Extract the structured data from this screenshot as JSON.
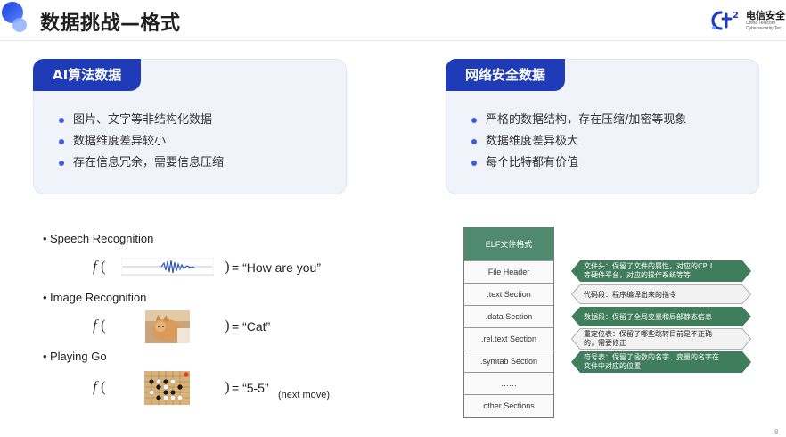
{
  "header": {
    "title": "数据挑战—格式",
    "logo": {
      "name": "电信安全",
      "sub_line1": "China Telecom",
      "sub_line2": "Cybersecurity Tec"
    }
  },
  "ai_panel": {
    "tag": "AI算法数据",
    "items": [
      "图片、文字等非结构化数据",
      "数据维度差异较小",
      "存在信息冗余，需要信息压缩"
    ]
  },
  "net_panel": {
    "tag": "网络安全数据",
    "items": [
      "严格的数据结构，存在压缩/加密等现象",
      "数据维度差异极大",
      "每个比特都有价值"
    ]
  },
  "examples": [
    {
      "label": "Speech Recognition",
      "result": "= “How are you”",
      "note": ""
    },
    {
      "label": "Image Recognition",
      "result": "= “Cat”",
      "note": ""
    },
    {
      "label": "Playing Go",
      "result": "= “5-5”",
      "note": "(next move)"
    }
  ],
  "math": {
    "func": "f",
    "open": "(",
    "close": ")"
  },
  "elf": {
    "title": "ELF文件格式",
    "rows": [
      "File Header",
      ".text Section",
      ".data Section",
      ".rel.text Section",
      ".symtab Section",
      "……",
      "other Sections"
    ]
  },
  "callouts": [
    {
      "line1": "文件头：保留了文件的属性，对应的CPU",
      "line2": "等硬件平台，对应的操作系统等等",
      "fill": "#3f7d5d",
      "text_color": "#ffffff"
    },
    {
      "line1": "代码段：程序编译出来的指令",
      "line2": "",
      "fill": "#f2f2f2",
      "text_color": "#222222"
    },
    {
      "line1": "数据段：保留了全局变量和局部静态信息",
      "line2": "",
      "fill": "#3f7d5d",
      "text_color": "#ffffff"
    },
    {
      "line1": "重定位表：保留了哪些跳转目前是不正确",
      "line2": "的，需要修正",
      "fill": "#f2f2f2",
      "text_color": "#222222"
    },
    {
      "line1": "符号表：保留了函数的名字、变量的名字在",
      "line2": "文件中对应的位置",
      "fill": "#3f7d5d",
      "text_color": "#ffffff"
    }
  ],
  "page_number": "8",
  "colors": {
    "accent": "#1f3bb8",
    "bullet": "#3a5ae8",
    "elf_header": "#4f8a6f",
    "panel_bg": "#f1f3fb"
  }
}
